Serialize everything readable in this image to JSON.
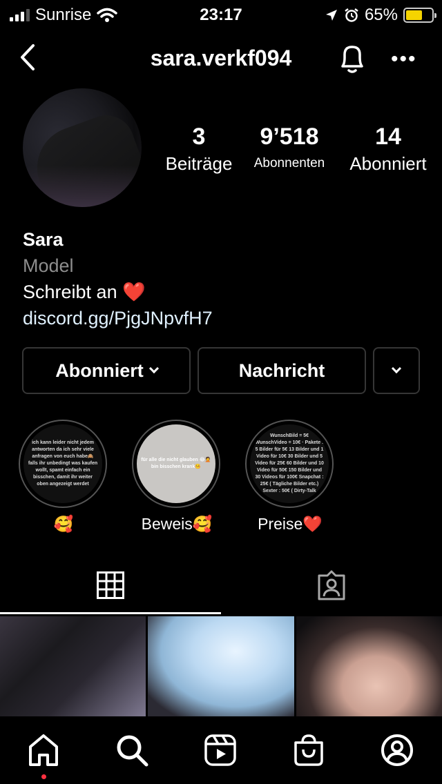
{
  "status_bar": {
    "carrier": "Sunrise",
    "time": "23:17",
    "battery_percent": "65%",
    "battery_level": 0.65,
    "icons": [
      "signal-icon",
      "wifi-icon",
      "location-icon",
      "alarm-icon",
      "battery-icon"
    ]
  },
  "header": {
    "username": "sara.verkf094",
    "icons": [
      "back-chevron-icon",
      "bell-icon",
      "more-icon"
    ]
  },
  "profile": {
    "stats": [
      {
        "value": "3",
        "label": "Beiträge"
      },
      {
        "value": "9’518",
        "label": "Abonnenten"
      },
      {
        "value": "14",
        "label": "Abonniert"
      }
    ],
    "name": "Sara",
    "category": "Model",
    "bio_line": "Schreibt an ❤️",
    "link": "discord.gg/PjgJNpvfH7"
  },
  "actions": {
    "follow_label": "Abonniert",
    "message_label": "Nachricht"
  },
  "highlights": [
    {
      "label": "🥰",
      "cover_text": "ich kann leider nicht jedem antworten da ich sehr viele anfragen von euch habe🙈 falls ihr unbedingt was kaufen wollt, spamt einfach ein bisschen, damit ihr weiter oben angezeigt werdet"
    },
    {
      "label": "Beweis🥰",
      "cover_text": "für alle die nicht glauben 😂🤦 bin bisschen krank🤒"
    },
    {
      "label": "Preise❤️",
      "cover_text": "WunschBild = 5€ WunschVideo = 10€ · Pakete : 5 Bilder für 5€ 13 Bilder und 1 Video für 10€ 30 Bilder und 5 Video für 25€ 60 Bilder und 10 Video für 50€ 150 Bilder und 30 Videos für 100€ Snapchat : 25€ ( Tägliche Bilder etc.) Sexter : 50€ ( Dirty-Talk"
    }
  ],
  "tabs": {
    "active": "posts",
    "icons": [
      "grid-icon",
      "tagged-icon"
    ]
  },
  "bottom_nav": {
    "icons": [
      "home-icon",
      "search-icon",
      "reels-icon",
      "shop-icon",
      "profile-icon"
    ]
  }
}
